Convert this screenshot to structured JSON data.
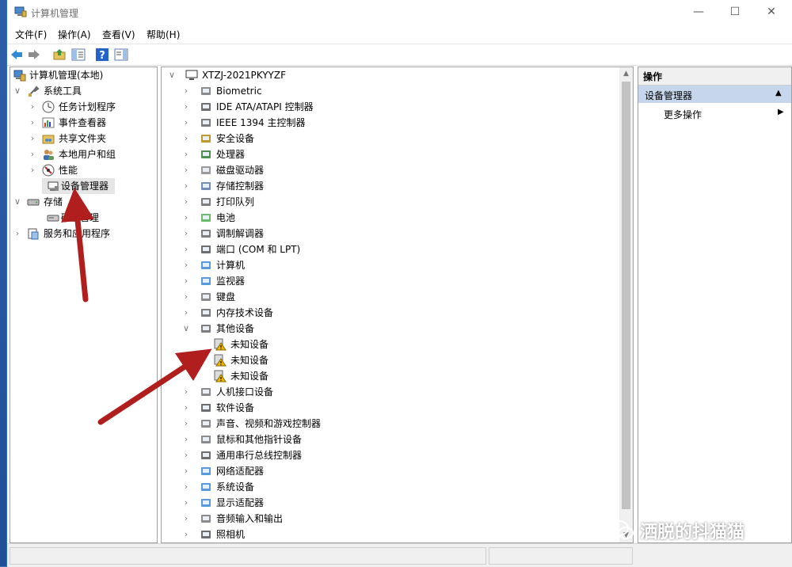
{
  "window": {
    "title": "计算机管理"
  },
  "menus": [
    "文件(F)",
    "操作(A)",
    "查看(V)",
    "帮助(H)"
  ],
  "left_tree": {
    "root": "计算机管理(本地)",
    "system_tools": "系统工具",
    "task_scheduler": "任务计划程序",
    "event_viewer": "事件查看器",
    "shared_folders": "共享文件夹",
    "local_users": "本地用户和组",
    "performance": "性能",
    "device_manager": "设备管理器",
    "storage": "存储",
    "disk_management": "磁盘管理",
    "services_apps": "服务和应用程序"
  },
  "device_tree": {
    "computer": "XTZJ-2021PKYYZF",
    "categories": [
      "Biometric",
      "IDE ATA/ATAPI 控制器",
      "IEEE 1394 主控制器",
      "安全设备",
      "处理器",
      "磁盘驱动器",
      "存储控制器",
      "打印队列",
      "电池",
      "调制解调器",
      "端口 (COM 和 LPT)",
      "计算机",
      "监视器",
      "键盘",
      "内存技术设备",
      "其他设备",
      "人机接口设备",
      "软件设备",
      "声音、视频和游戏控制器",
      "鼠标和其他指针设备",
      "通用串行总线控制器",
      "网络适配器",
      "系统设备",
      "显示适配器",
      "音频输入和输出",
      "照相机"
    ],
    "unknown_devices": [
      "未知设备",
      "未知设备",
      "未知设备"
    ]
  },
  "actions": {
    "header": "操作",
    "section": "设备管理器",
    "more": "更多操作"
  },
  "watermark": "洒脱的抖猫猫",
  "colors": {
    "arrow": "#b01e1e",
    "selection": "#c6d6ec",
    "warning": "#f2b705"
  }
}
